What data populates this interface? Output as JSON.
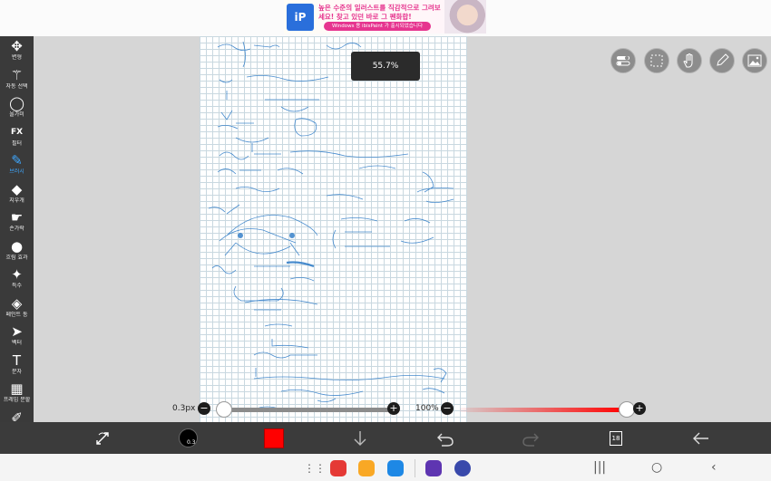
{
  "ad": {
    "logo": "iP",
    "line1": "높은 수준의 일러스트를 직감적으로 그려보",
    "line2": "세요! 찾고 있던 바로 그 펜화합!",
    "button": "Windows 용 ibisPaint 가 출시되었습니다"
  },
  "tools": [
    {
      "icon": "move-icon",
      "glyph": "✥",
      "label": "변형"
    },
    {
      "icon": "magic-wand-icon",
      "glyph": "⚚",
      "label": "자동 선택"
    },
    {
      "icon": "lasso-icon",
      "glyph": "◯",
      "label": "올가미"
    },
    {
      "icon": "fx-icon",
      "glyph": "FX",
      "label": "필터"
    },
    {
      "icon": "brush-icon",
      "glyph": "✎",
      "label": "브러시",
      "active": true
    },
    {
      "icon": "eraser-icon",
      "glyph": "◆",
      "label": "지우개"
    },
    {
      "icon": "smudge-icon",
      "glyph": "☛",
      "label": "손가락"
    },
    {
      "icon": "blur-icon",
      "glyph": "●",
      "label": "흐림 효과"
    },
    {
      "icon": "special-icon",
      "glyph": "✦",
      "label": "특수"
    },
    {
      "icon": "fill-icon",
      "glyph": "◈",
      "label": "페인트 통"
    },
    {
      "icon": "vector-icon",
      "glyph": "➤",
      "label": "벡터"
    },
    {
      "icon": "text-icon",
      "glyph": "T",
      "label": "문자"
    },
    {
      "icon": "frame-icon",
      "glyph": "▦",
      "label": "프레임 분할"
    },
    {
      "icon": "eyedropper-icon",
      "glyph": "✐",
      "label": "스포이드"
    }
  ],
  "zoom": "55.7%",
  "brush": {
    "size_label": "0.3px",
    "size_fraction": 0.03,
    "opacity_label": "100%",
    "opacity_fraction": 1.0,
    "size_badge": "0.3",
    "color": "#ff0000"
  },
  "layers": {
    "count": "18"
  },
  "quick_actions": [
    "toggle-icon",
    "selection-icon",
    "hand-icon",
    "pen-icon",
    "image-icon"
  ],
  "colors": {
    "toolbar": "#3a3a3a",
    "accent": "#3fa8ff",
    "ink": "#2a79c6"
  }
}
